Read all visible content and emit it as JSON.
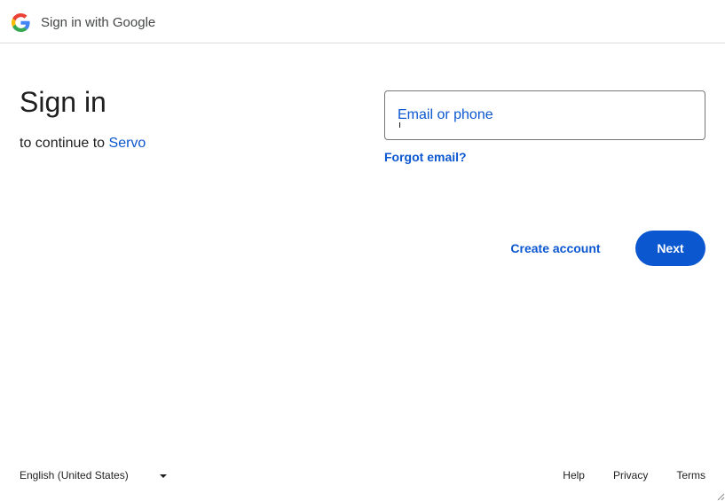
{
  "header": {
    "logo_icon": "google-g-icon",
    "title": "Sign in with Google"
  },
  "main": {
    "title": "Sign in",
    "subtitle_prefix": "to continue to",
    "app_name": "Servo"
  },
  "form": {
    "email_placeholder": "Email or phone",
    "email_value": "",
    "forgot_email": "Forgot email?",
    "create_account": "Create account",
    "next": "Next"
  },
  "footer": {
    "language": "English (United States)",
    "links": [
      "Help",
      "Privacy",
      "Terms"
    ]
  },
  "colors": {
    "accent": "#0b57d0",
    "text": "#1f1f1f",
    "divider": "#dadce0",
    "border": "#747775"
  }
}
